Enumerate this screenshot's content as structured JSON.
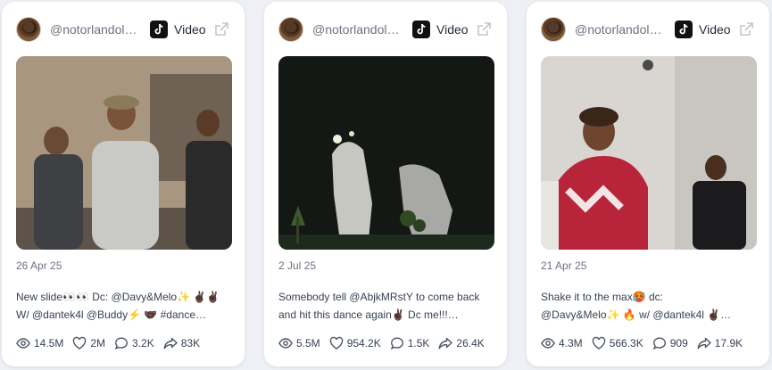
{
  "cards": [
    {
      "username": "@notorlandolu...",
      "platform_label": "Video",
      "date": "26 Apr 25",
      "caption_line1": "New slide👀👀 Dc: @Davy&Melo✨ ✌🏿✌🏿",
      "caption_line2": "W/ @dantek4l @Buddy⚡ 🤝🏿 #dance…",
      "stats": {
        "views": "14.5M",
        "likes": "2M",
        "comments": "3.2K",
        "shares": "83K"
      }
    },
    {
      "username": "@notorlandolu...",
      "platform_label": "Video",
      "date": "2 Jul 25",
      "caption_line1": "Somebody tell @AbjkMRstY to come back",
      "caption_line2": "and hit this dance again✌🏿 Dc me!!!…",
      "stats": {
        "views": "5.5M",
        "likes": "954.2K",
        "comments": "1.5K",
        "shares": "26.4K"
      }
    },
    {
      "username": "@notorlandolu...",
      "platform_label": "Video",
      "date": "21 Apr 25",
      "caption_line1": "Shake it to the max🥵 dc:",
      "caption_line2": "@Davy&Melo✨ 🔥 w/ @dantek4l ✌🏿…",
      "stats": {
        "views": "4.3M",
        "likes": "566.3K",
        "comments": "909",
        "shares": "17.9K"
      }
    }
  ],
  "icons": {
    "platform": "tiktok-icon",
    "external": "external-link-icon",
    "views": "eye-icon",
    "likes": "heart-icon",
    "comments": "comment-icon",
    "shares": "share-icon"
  }
}
